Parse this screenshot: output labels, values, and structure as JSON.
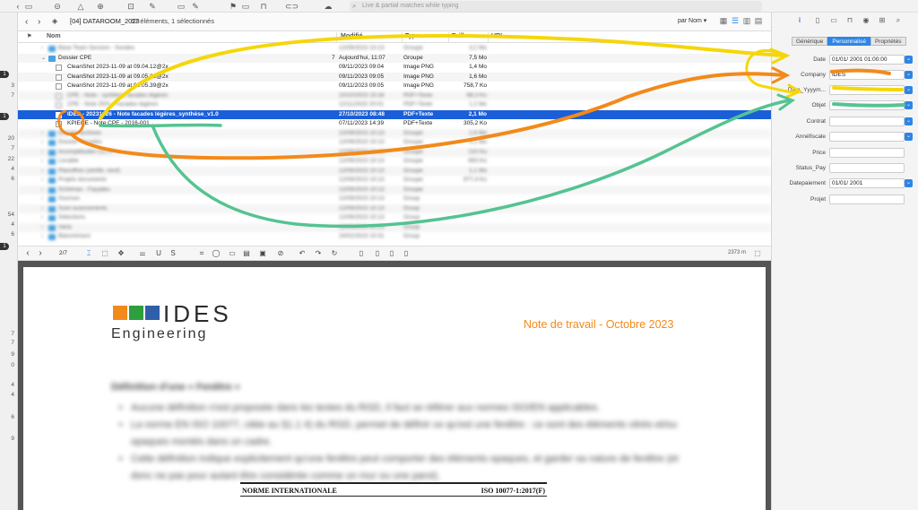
{
  "toolbar": {
    "search_placeholder": "Live & partial matches while typing",
    "icons": [
      "back-icon",
      "add-icon",
      "warning-icon",
      "edit-icon",
      "inbox-icon",
      "flag-icon",
      "tag-icon",
      "lock-icon",
      "share-icon",
      "capsule-icon",
      "cloud-icon",
      "search-icon"
    ]
  },
  "gutter": {
    "numbers": [
      "1",
      "3",
      "7",
      "20",
      "7",
      "22",
      "4",
      "6",
      "54",
      "4",
      "6",
      "9",
      "7",
      "7",
      "9",
      "0",
      "4",
      "4",
      "6",
      "9"
    ]
  },
  "pathbar": {
    "db_title": "[04] DATAROOM_2023",
    "count": "67 éléments, 1 sélectionnés",
    "sort": "par Nom"
  },
  "columns": {
    "name": "Nom",
    "modified": "Modifié",
    "type": "Type",
    "size": "Taille",
    "url": "URL"
  },
  "rows": [
    {
      "name": "Base Team Session - Sondes",
      "modified": "12/09/2023 10:13",
      "type": "Groupe",
      "size": "3,2 Mo",
      "blur": true
    },
    {
      "name": "Dossier CPE",
      "modified": "Aujourd'hui, 11:07",
      "type": "Groupe",
      "size": "7,5 Mo",
      "count": "7"
    },
    {
      "name": "CleanShot 2023-11-09 at 09.04.12@2x",
      "modified": "09/11/2023 09:04",
      "type": "Image PNG",
      "size": "1,4 Mo"
    },
    {
      "name": "CleanShot 2023-11-09 at 09.05.32@2x",
      "modified": "09/11/2023 09:05",
      "type": "Image PNG",
      "size": "1,6 Mo"
    },
    {
      "name": "CleanShot 2023-11-09 at 09.05.39@2x",
      "modified": "09/11/2023 09:05",
      "type": "Image PNG",
      "size": "758,7 Ko"
    },
    {
      "name": "CPE - Note - synthèse facades légères",
      "modified": "10/10/2023 15:34",
      "type": "PDF+Texte",
      "size": "68,3 Ko",
      "blur": true
    },
    {
      "name": "CPE - Note ZKN - Facades légères",
      "modified": "12/11/2023 20:01",
      "type": "PDF+Texte",
      "size": "1,2 Mo",
      "blur": true
    },
    {
      "name": "IDES - 20231026 - Note facades légères_synthèse_v1.0",
      "modified": "27/10/2023 08:48",
      "type": "PDF+Texte",
      "size": "2,1 Mo",
      "selected": true
    },
    {
      "name": "KPIECE - Note CPE - 2016-001",
      "modified": "07/11/2023 14:39",
      "type": "PDF+Texte",
      "size": "305,2 Ko"
    },
    {
      "name": "Dossier archives",
      "modified": "12/09/2023 10:13",
      "type": "Groupe",
      "size": "1,6 Mo",
      "blur": true
    },
    {
      "name": "Dossier Facades",
      "modified": "12/09/2023 10:13",
      "type": "Groupe",
      "size": "4,1 Mo",
      "blur": true
    },
    {
      "name": "Incomplétudes CCTP",
      "modified": "12/09/2023 10:13",
      "type": "Groupe",
      "size": "210 Ko",
      "blur": true
    },
    {
      "name": "Livrable",
      "modified": "12/09/2023 10:13",
      "type": "Groupe",
      "size": "893 Ko",
      "blur": true
    },
    {
      "name": "Planoffres (vérifié, neuf)",
      "modified": "12/09/2023 10:13",
      "type": "Groupe",
      "size": "1,1 Mo",
      "blur": true
    },
    {
      "name": "Projets documents",
      "modified": "12/09/2023 10:13",
      "type": "Groupe",
      "size": "977,4 Ko",
      "blur": true
    },
    {
      "name": "Schémas - Façades",
      "modified": "12/09/2023 10:13",
      "type": "Groupe",
      "size": "",
      "blur": true
    },
    {
      "name": "Sources",
      "modified": "12/09/2023 10:13",
      "type": "Group",
      "size": "",
      "blur": true
    },
    {
      "name": "Suivi avancements",
      "modified": "12/09/2023 10:13",
      "type": "Group",
      "size": "",
      "blur": true
    },
    {
      "name": "Sélections",
      "modified": "12/09/2023 10:13",
      "type": "Group",
      "size": "",
      "blur": true
    },
    {
      "name": "Varia",
      "modified": "12/09/2023 10:13",
      "type": "Group",
      "size": "",
      "blur": true
    },
    {
      "name": "Blanchiment",
      "modified": "24/02/2023 10:31",
      "type": "Group",
      "size": "",
      "blur": true
    }
  ],
  "pdfbar": {
    "page": "2/7",
    "zoom": "2373 m"
  },
  "pdf": {
    "logo_word": "IDES",
    "logo_sub": "Engineering",
    "logo_colors": [
      "#f28a1b",
      "#2e9e3e",
      "#2f5fa8"
    ],
    "note_title": "Note de travail - Octobre 2023",
    "blur_heading": "Définition d'une « Fenêtre »",
    "blur_bullets": [
      "Aucune définition n'est proposée dans les textes du RGD, il faut se référer aux normes ISO/EN applicables.",
      "La norme EN ISO 10077, citée au §1.1 4) du RGD, permet de définir ce qu'est une fenêtre : ce sont des éléments vitrés et/ou opaques montés dans un cadre.",
      "Cette définition indique explicitement qu'une fenêtre peut comporter des éléments opaques, et garder sa nature de fenêtre (et donc ne pas pour autant être considérée comme un mur ou une paroi)."
    ],
    "norme_left": "NORME INTERNATIONALE",
    "norme_right": "ISO 10077-1:2017(F)"
  },
  "inspector": {
    "tabs": [
      "Générique",
      "Personnalisé",
      "Propriétés"
    ],
    "active_tab": "Personnalisé",
    "fields": [
      {
        "label": "Date",
        "value": "01/01/ 2001  01:00:00"
      },
      {
        "label": "Company",
        "value": "IDES"
      },
      {
        "label": "Date_Yyyym...",
        "value": ""
      },
      {
        "label": "Objet",
        "value": ""
      },
      {
        "label": "Contrat",
        "value": ""
      },
      {
        "label": "Annéfiscale",
        "value": ""
      },
      {
        "label": "Price",
        "value": ""
      },
      {
        "label": "Status_Pay",
        "value": ""
      },
      {
        "label": "Datepaiement",
        "value": "01/01/ 2001"
      },
      {
        "label": "Projet",
        "value": ""
      }
    ]
  },
  "annotation_colors": {
    "yellow": "#f5d60a",
    "orange": "#f28a1b",
    "green": "#55c391"
  }
}
